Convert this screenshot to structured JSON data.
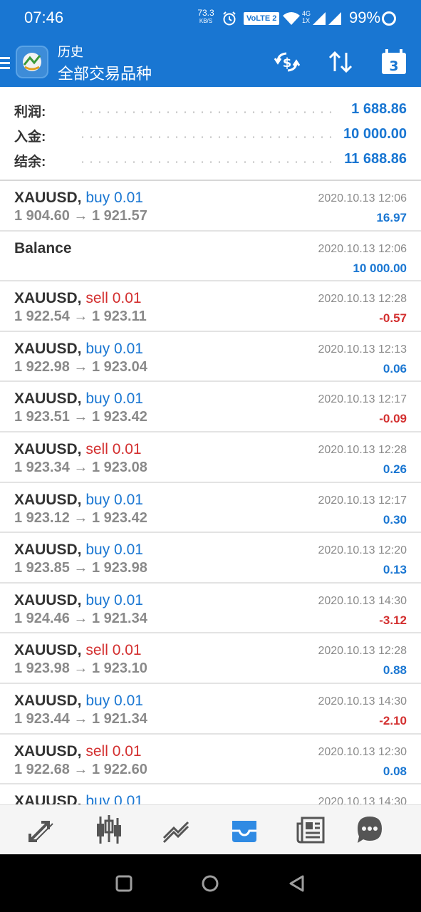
{
  "status_bar": {
    "time": "07:46",
    "net_speed_value": "73.3",
    "net_speed_unit": "KB/S",
    "volte_label": "VoLTE 2",
    "network_label_top": "4G",
    "network_label_bottom": "1X",
    "battery": "99%"
  },
  "app_bar": {
    "title": "历史",
    "subtitle": "全部交易品种",
    "calendar_day": "3",
    "accent_color": "#1976d2"
  },
  "summary": [
    {
      "label": "利润:",
      "value": "1 688.86"
    },
    {
      "label": "入金:",
      "value": "10 000.00"
    },
    {
      "label": "结余:",
      "value": "11 688.86"
    }
  ],
  "deals": [
    {
      "symbol": "XAUUSD,",
      "side": "buy 0.01",
      "side_type": "buy",
      "prices": "1 904.60 → 1 921.57",
      "time": "2020.10.13 12:06",
      "profit": "16.97",
      "profit_sign": "pos"
    },
    {
      "symbol": "Balance",
      "side": "",
      "side_type": "",
      "prices": "",
      "time": "2020.10.13 12:06",
      "profit": "10 000.00",
      "profit_sign": "pos"
    },
    {
      "symbol": "XAUUSD,",
      "side": "sell 0.01",
      "side_type": "sell",
      "prices": "1 922.54 → 1 923.11",
      "time": "2020.10.13 12:28",
      "profit": "-0.57",
      "profit_sign": "neg"
    },
    {
      "symbol": "XAUUSD,",
      "side": "buy 0.01",
      "side_type": "buy",
      "prices": "1 922.98 → 1 923.04",
      "time": "2020.10.13 12:13",
      "profit": "0.06",
      "profit_sign": "pos"
    },
    {
      "symbol": "XAUUSD,",
      "side": "buy 0.01",
      "side_type": "buy",
      "prices": "1 923.51 → 1 923.42",
      "time": "2020.10.13 12:17",
      "profit": "-0.09",
      "profit_sign": "neg"
    },
    {
      "symbol": "XAUUSD,",
      "side": "sell 0.01",
      "side_type": "sell",
      "prices": "1 923.34 → 1 923.08",
      "time": "2020.10.13 12:28",
      "profit": "0.26",
      "profit_sign": "pos"
    },
    {
      "symbol": "XAUUSD,",
      "side": "buy 0.01",
      "side_type": "buy",
      "prices": "1 923.12 → 1 923.42",
      "time": "2020.10.13 12:17",
      "profit": "0.30",
      "profit_sign": "pos"
    },
    {
      "symbol": "XAUUSD,",
      "side": "buy 0.01",
      "side_type": "buy",
      "prices": "1 923.85 → 1 923.98",
      "time": "2020.10.13 12:20",
      "profit": "0.13",
      "profit_sign": "pos"
    },
    {
      "symbol": "XAUUSD,",
      "side": "buy 0.01",
      "side_type": "buy",
      "prices": "1 924.46 → 1 921.34",
      "time": "2020.10.13 14:30",
      "profit": "-3.12",
      "profit_sign": "neg"
    },
    {
      "symbol": "XAUUSD,",
      "side": "sell 0.01",
      "side_type": "sell",
      "prices": "1 923.98 → 1 923.10",
      "time": "2020.10.13 12:28",
      "profit": "0.88",
      "profit_sign": "pos"
    },
    {
      "symbol": "XAUUSD,",
      "side": "buy 0.01",
      "side_type": "buy",
      "prices": "1 923.44 → 1 921.34",
      "time": "2020.10.13 14:30",
      "profit": "-2.10",
      "profit_sign": "neg"
    },
    {
      "symbol": "XAUUSD,",
      "side": "sell 0.01",
      "side_type": "sell",
      "prices": "1 922.68 → 1 922.60",
      "time": "2020.10.13 12:30",
      "profit": "0.08",
      "profit_sign": "pos"
    },
    {
      "symbol": "XAUUSD,",
      "side": "buy 0.01",
      "side_type": "buy",
      "prices": "",
      "time": "2020.10.13 14:30",
      "profit": "",
      "profit_sign": "pos"
    }
  ],
  "bottom_nav": [
    {
      "icon": "quotes-arrows-icon",
      "active": false
    },
    {
      "icon": "candlestick-chart-icon",
      "active": false
    },
    {
      "icon": "trade-line-icon",
      "active": false
    },
    {
      "icon": "history-inbox-icon",
      "active": true
    },
    {
      "icon": "news-icon",
      "active": false
    },
    {
      "icon": "chat-icon",
      "active": false
    }
  ],
  "colors": {
    "primary": "#1976d2",
    "sell": "#d32f2f",
    "nav_icon": "#555555"
  }
}
